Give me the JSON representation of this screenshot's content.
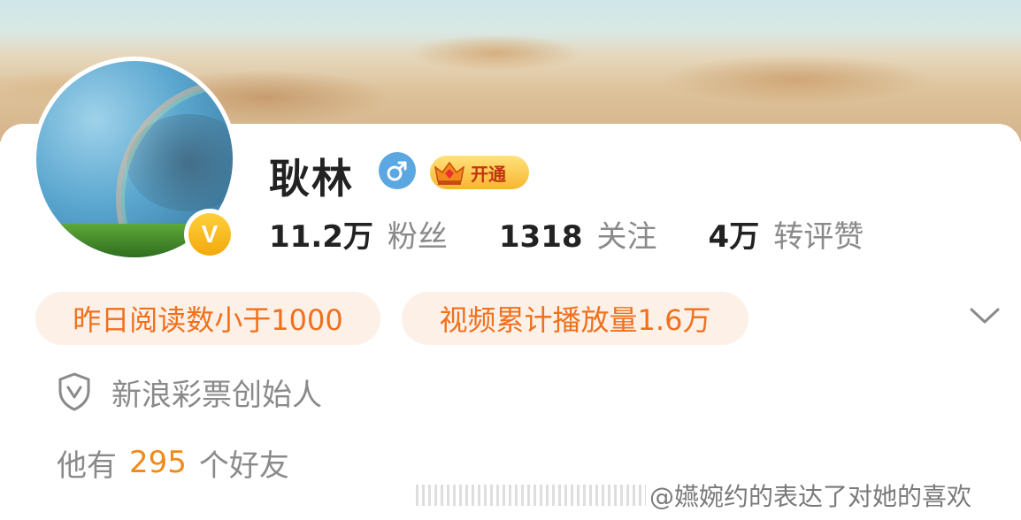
{
  "profile": {
    "name": "耿林",
    "verified_mark": "V",
    "vip_label": "开通",
    "gender": "male"
  },
  "stats": [
    {
      "value": "11.2万",
      "label": "粉丝"
    },
    {
      "value": "1318",
      "label": "关注"
    },
    {
      "value": "4万",
      "label": "转评赞"
    }
  ],
  "tags": [
    "昨日阅读数小于1000",
    "视频累计播放量1.6万"
  ],
  "role": "新浪彩票创始人",
  "friends": {
    "prefix": "他有",
    "count": "295",
    "suffix": "个好友"
  },
  "watermark": "@嬿婉约的表达了对她的喜欢",
  "colors": {
    "tag_text": "#f0701c",
    "tag_bg": "#fdf0e7",
    "friend_count": "#f08a1a",
    "gender_bg": "#5aa7e2",
    "verify_badge": "#f3a90f"
  },
  "icons": [
    "male-icon",
    "vip-crown-icon",
    "verified-badge-icon",
    "chevron-down-icon",
    "shield-check-icon"
  ]
}
